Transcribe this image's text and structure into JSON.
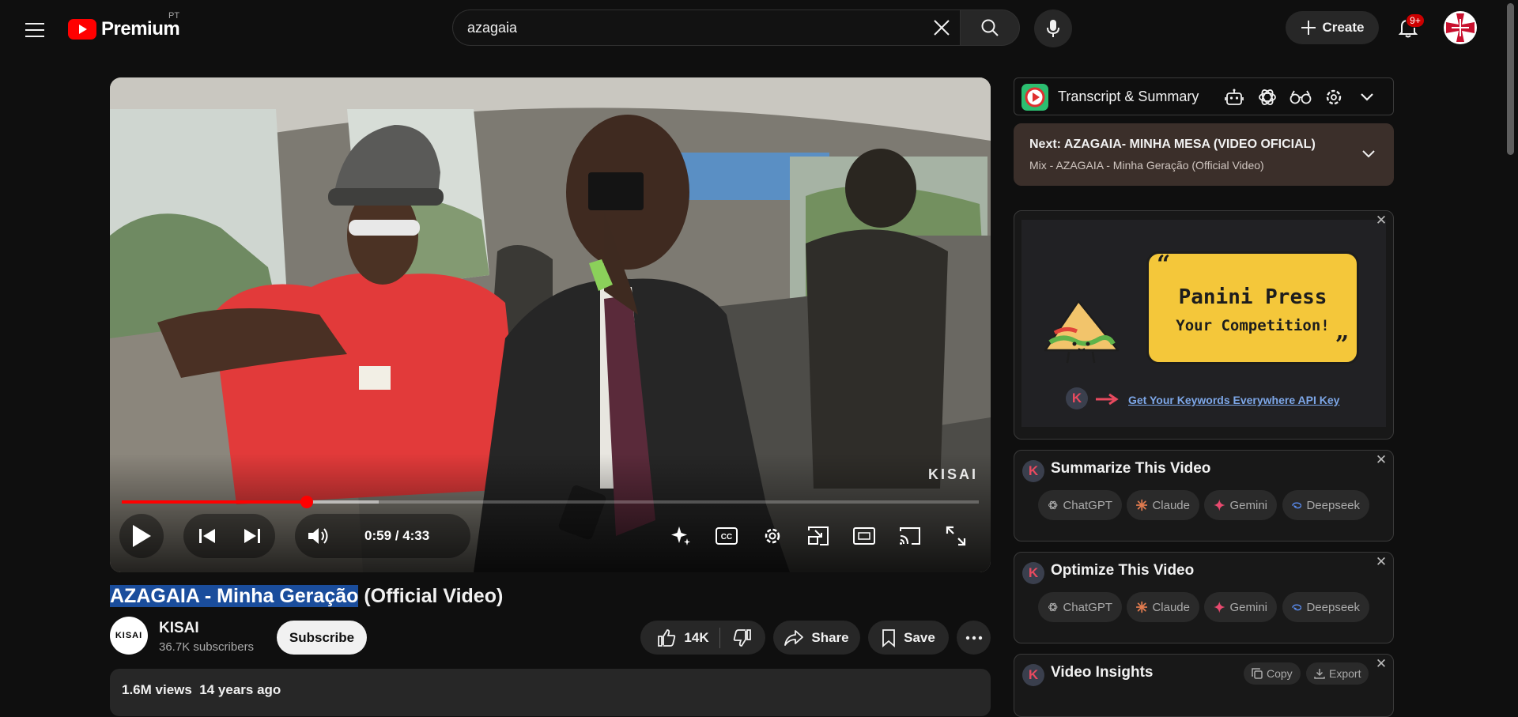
{
  "header": {
    "logo_text": "Premium",
    "country_code": "PT",
    "search_value": "azagaia",
    "create_label": "Create",
    "notification_count": "9+"
  },
  "player": {
    "watermark": "KISAI",
    "current_time": "0:59",
    "duration": "4:33",
    "time_display": "0:59 / 4:33",
    "progress_fraction": 0.216,
    "buffered_fraction": 0.3
  },
  "video": {
    "title_highlighted": "AZAGAIA - Minha Geração",
    "title_rest": " (Official Video)"
  },
  "channel": {
    "avatar_text": "KISAI",
    "name": "KISAI",
    "subscribers": "36.7K subscribers",
    "subscribe_label": "Subscribe"
  },
  "actions": {
    "likes": "14K",
    "share_label": "Share",
    "save_label": "Save"
  },
  "description": {
    "views": "1.6M views",
    "age": "14 years ago"
  },
  "sidebar": {
    "transcript_title": "Transcript & Summary",
    "next_label": "Next:",
    "next_title": "AZAGAIA- MINHA MESA (VIDEO OFICIAL)",
    "next_mix": "Mix - AZAGAIA - Minha Geração (Official Video)",
    "ad": {
      "line1": "Panini Press",
      "line2": "Your Competition!",
      "link": "Get Your Keywords Everywhere API Key"
    },
    "badge_letter": "K",
    "summarize_title": "Summarize This Video",
    "optimize_title": "Optimize This Video",
    "insights_title": "Video Insights",
    "copy_label": "Copy",
    "export_label": "Export",
    "ai_tools": [
      "ChatGPT",
      "Claude",
      "Gemini",
      "Deepseek"
    ]
  },
  "colors": {
    "accent_red": "#ff0000",
    "background": "#0f0f0f",
    "chip": "#272727",
    "highlight": "#1a4d9c",
    "ad_yellow": "#f4c73a"
  }
}
